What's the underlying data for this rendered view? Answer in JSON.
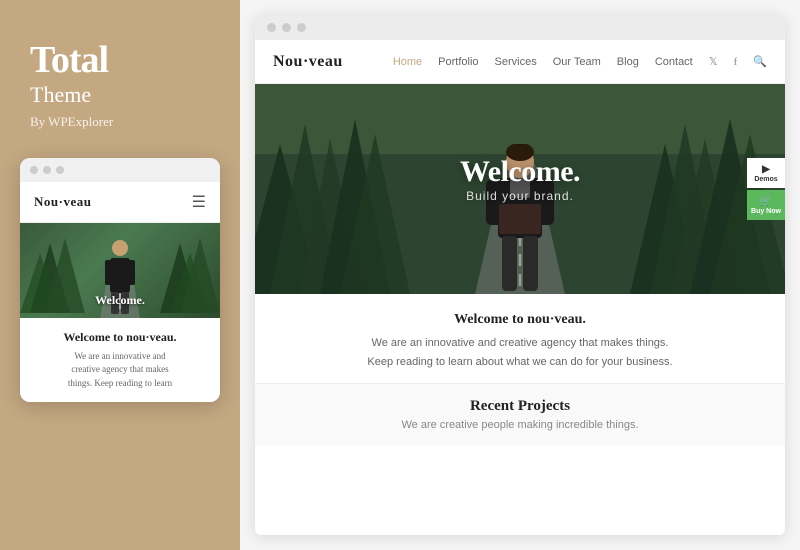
{
  "left": {
    "title": "Total",
    "subtitle": "Theme",
    "by": "By WPExplorer"
  },
  "mobile": {
    "brand": "Nou·veau",
    "hero_text": "Welcome.",
    "content_title": "Welcome to nou·veau.",
    "content_text": "We are an innovative and\ncreative agency that makes\nthings. Keep reading to learn"
  },
  "browser": {
    "brand": "Nou·veau",
    "nav_links": [
      {
        "label": "Home",
        "active": true
      },
      {
        "label": "Portfolio",
        "active": false
      },
      {
        "label": "Services",
        "active": false
      },
      {
        "label": "Our Team",
        "active": false
      },
      {
        "label": "Blog",
        "active": false
      },
      {
        "label": "Contact",
        "active": false
      }
    ],
    "hero_welcome": "Welcome.",
    "hero_tagline": "Build your brand.",
    "btn_demos": "Demos",
    "btn_buy": "Buy Now",
    "content_title": "Welcome to nou·veau.",
    "content_text_1": "We are an innovative and creative agency that makes things.",
    "content_text_2": "Keep reading to learn about what we can do for your business.",
    "section_title": "Recent Projects",
    "section_sub": "We are creative people making incredible things."
  },
  "colors": {
    "tan": "#c4a882",
    "green_dark": "#2d4a2d",
    "green_mid": "#4a7a50"
  }
}
